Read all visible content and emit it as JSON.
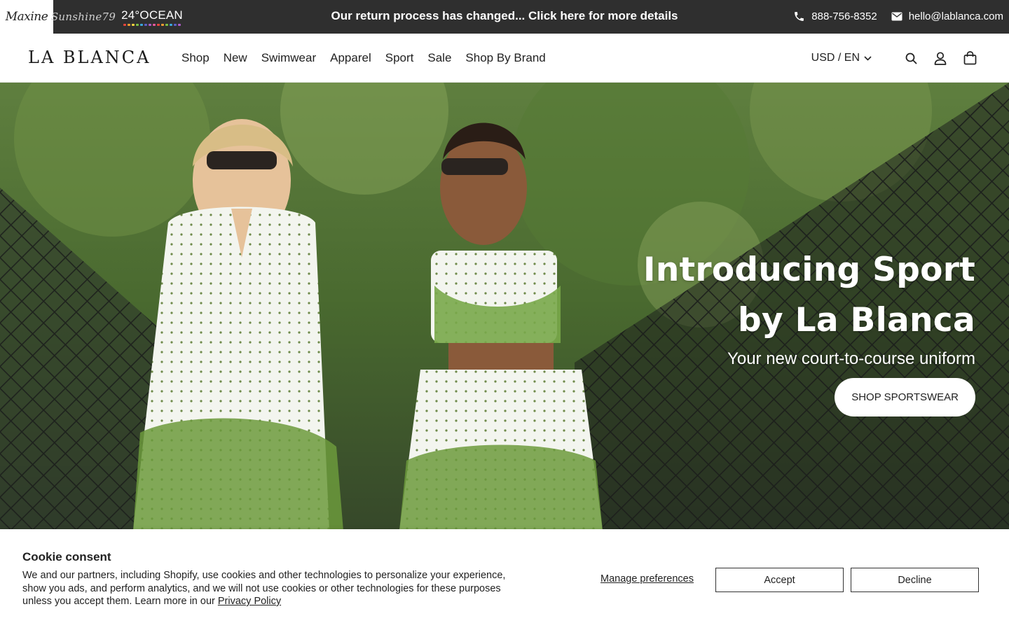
{
  "announcement": {
    "brands": [
      {
        "label": "Maxine"
      },
      {
        "label": "Sunshine79"
      },
      {
        "label": "24°OCEAN"
      }
    ],
    "ocean_dot_colors": [
      "#e8453c",
      "#f39c32",
      "#f7d23e",
      "#7bc043",
      "#3aa6dd",
      "#5b5fc7",
      "#b05bc7",
      "#e85a9b",
      "#e8453c",
      "#f39c32",
      "#7bc043",
      "#3aa6dd",
      "#5b5fc7",
      "#b05bc7"
    ],
    "message": "Our return process has changed... Click here for more details",
    "phone": "888-756-8352",
    "email": "hello@lablanca.com"
  },
  "header": {
    "logo": "LA BLANCA",
    "nav": [
      {
        "label": "Shop"
      },
      {
        "label": "New"
      },
      {
        "label": "Swimwear"
      },
      {
        "label": "Apparel"
      },
      {
        "label": "Sport"
      },
      {
        "label": "Sale"
      },
      {
        "label": "Shop By Brand"
      }
    ],
    "currency": "USD / EN",
    "icons": [
      "search-icon",
      "account-icon",
      "cart-icon"
    ]
  },
  "hero": {
    "title_line1": "Introducing Sport",
    "title_line2": "by La Blanca",
    "subtitle": "Your new court-to-course uniform",
    "button": "SHOP SPORTSWEAR"
  },
  "cookie": {
    "title": "Cookie consent",
    "body": "We and our partners, including Shopify, use cookies and other technologies to personalize your experience, show you ads, and perform analytics, and we will not use cookies or other technologies for these purposes unless you accept them. Learn more in our ",
    "privacy_link": "Privacy Policy",
    "manage": "Manage preferences",
    "accept": "Accept",
    "decline": "Decline"
  },
  "colors": {
    "topbar_bg": "#2f2f2f",
    "banner_bg": "#ffffff",
    "text": "#222222"
  }
}
